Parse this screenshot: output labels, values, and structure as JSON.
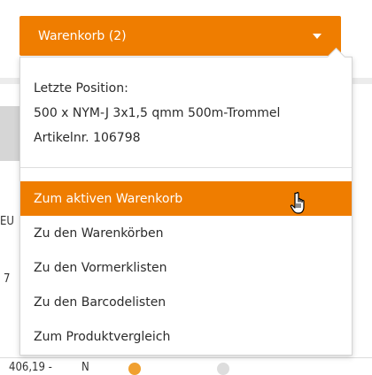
{
  "colors": {
    "accent": "#ef7d00",
    "text": "#2b2b2b"
  },
  "cart": {
    "header_label": "Warenkorb (2)",
    "caret_icon": "caret-down-icon"
  },
  "last_position": {
    "title": "Letzte Position:",
    "product": "500 x NYM-J 3x1,5 qmm 500m-Trommel",
    "article": "Artikelnr. 106798"
  },
  "menu": {
    "items": [
      {
        "label": "Zum aktiven Warenkorb",
        "active": true
      },
      {
        "label": "Zu den Warenkörben"
      },
      {
        "label": "Zu den Vormerklisten"
      },
      {
        "label": "Zu den Barcodelisten"
      },
      {
        "label": "Zum Produktvergleich"
      }
    ]
  },
  "background": {
    "fragments": [
      "EU",
      "7",
      "406,19 -",
      "N"
    ]
  },
  "cursor_icon": "hand-pointer-icon"
}
